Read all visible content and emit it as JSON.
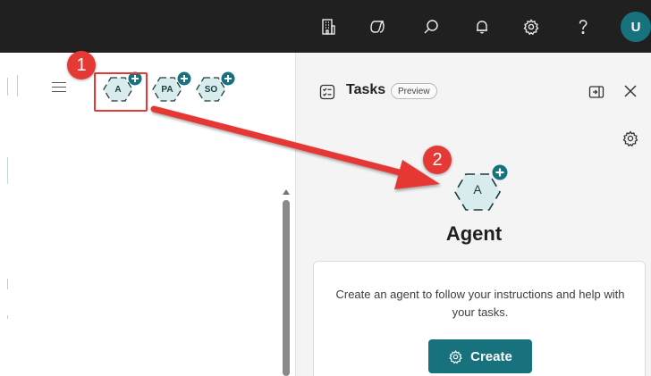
{
  "topbar": {
    "avatar_initial": "U",
    "icons": [
      "building-icon",
      "copilot-icon",
      "search-icon",
      "bell-icon",
      "gear-icon",
      "help-icon"
    ]
  },
  "agents": [
    {
      "label": "A"
    },
    {
      "label": "PA"
    },
    {
      "label": "SO"
    }
  ],
  "annotations": {
    "step1": "1",
    "step2": "2",
    "highlight_color": "#e53935"
  },
  "tasks_panel": {
    "title": "Tasks",
    "preview_label": "Preview",
    "agent_initial": "A",
    "agent_title": "Agent",
    "description": "Create an agent to follow your instructions and help with your tasks.",
    "create_label": "Create"
  },
  "colors": {
    "accent": "#17727d",
    "topbar": "#202020",
    "panel": "#f4f4f4",
    "chip_fill": "#d8ecee"
  }
}
